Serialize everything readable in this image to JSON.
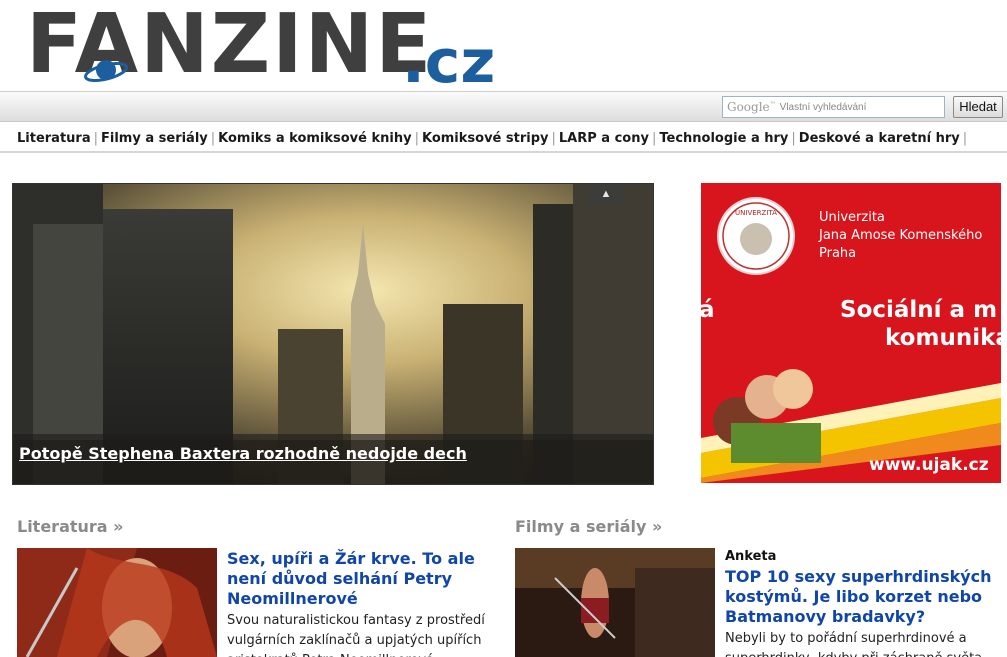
{
  "logo": {
    "word": "FANZINE",
    "tld": ".cz"
  },
  "search": {
    "brand": "Google",
    "brand_tm": "™",
    "placeholder": "Vlastní vyhledávání",
    "button_label": "Hledat"
  },
  "nav": {
    "items": [
      "Literatura",
      "Filmy a seriály",
      "Komiks a komiksové knihy",
      "Komiksové stripy",
      "LARP a cony",
      "Technologie a hry",
      "Deskové a karetní hry"
    ],
    "separator": "|"
  },
  "hero": {
    "caption": "Potopě Stephena Baxtera rozhodně nedojde dech",
    "up_arrow": "▲"
  },
  "ad": {
    "university_lines": [
      "Univerzita",
      "Jana Amose Komenského",
      "Praha"
    ],
    "slogan_line1": "Sociální a m",
    "slogan_line2": "komunika",
    "slogan_left": "á",
    "url": "www.ujak.cz",
    "seal_text": "UNIVERZITA",
    "colors": {
      "background": "#d8141c",
      "stripe_yellow": "#f5c400",
      "stripe_orange": "#f08a1c"
    }
  },
  "sections": {
    "literatura": {
      "title": "Literatura »",
      "article": {
        "title": "Sex, upíři a Žár krve. To ale není důvod selhání Petry Neomillnerové",
        "text": "Svou naturalistickou fantasy z prostředí vulgárních zaklínačů a upjatých upířích aristokratů Petra Neomillnerová"
      }
    },
    "filmy": {
      "title": "Filmy a seriály »",
      "article": {
        "kicker": "Anketa",
        "title": "TOP 10 sexy superhrdinských kostýmů. Je libo korzet nebo Batmanovy bradavky?",
        "text": "Nebyli by to pořádní superhrdinové a superhrdinky, kdyby při záchraně světa"
      }
    }
  },
  "colors": {
    "link": "#1046a8",
    "logo_grey": "#3f3f3f",
    "logo_blue": "#1d5f9e",
    "section_grey": "#8a8a8a"
  }
}
